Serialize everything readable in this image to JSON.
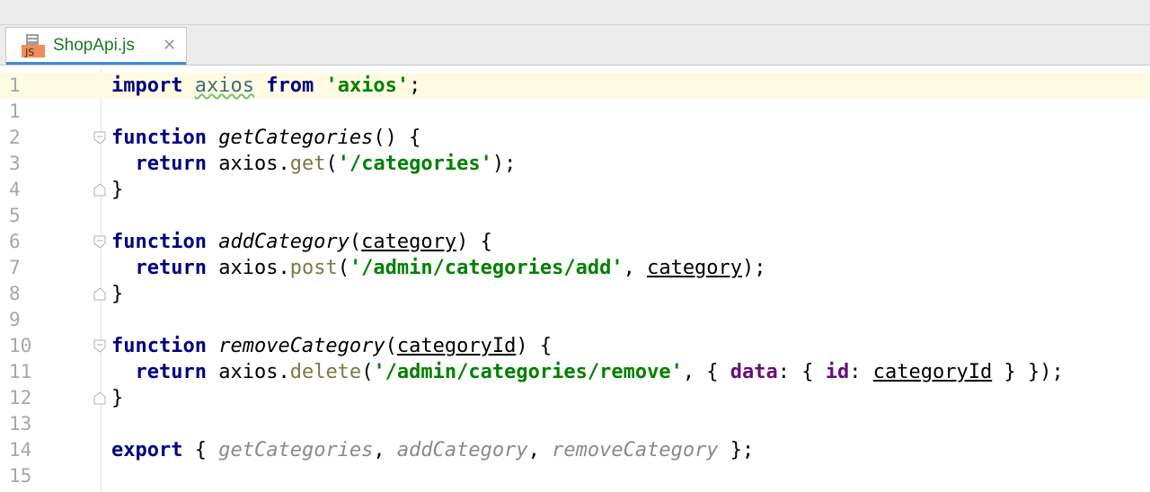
{
  "tab": {
    "filename": "ShopApi.js",
    "icon_text": "JS",
    "close_glyph": "✕"
  },
  "colors": {
    "keyword": "#000080",
    "string": "#008000",
    "method": "#7a7a43",
    "property": "#660e7a",
    "gutter_number": "#a7a7a7",
    "current_line": "#fffbe2",
    "tab_label": "#1a7a24"
  },
  "lines": [
    {
      "num": "1",
      "tokens": [
        "import",
        " ",
        "axios",
        " ",
        "from",
        " ",
        "'axios'",
        ";"
      ]
    },
    {
      "num": "1",
      "tokens": []
    },
    {
      "num": "2",
      "tokens": [
        "function",
        " ",
        "getCategories",
        "() {"
      ]
    },
    {
      "num": "3",
      "tokens": [
        "  ",
        "return",
        " axios.",
        "get",
        "(",
        "'/categories'",
        ");"
      ]
    },
    {
      "num": "4",
      "tokens": [
        "}"
      ]
    },
    {
      "num": "5",
      "tokens": []
    },
    {
      "num": "6",
      "tokens": [
        "function",
        " ",
        "addCategory",
        "(",
        "category",
        ") {"
      ]
    },
    {
      "num": "7",
      "tokens": [
        "  ",
        "return",
        " axios.",
        "post",
        "(",
        "'/admin/categories/add'",
        ", ",
        "category",
        ");"
      ]
    },
    {
      "num": "8",
      "tokens": [
        "}"
      ]
    },
    {
      "num": "9",
      "tokens": []
    },
    {
      "num": "10",
      "tokens": [
        "function",
        " ",
        "removeCategory",
        "(",
        "categoryId",
        ") {"
      ]
    },
    {
      "num": "11",
      "tokens": [
        "  ",
        "return",
        " axios.",
        "delete",
        "(",
        "'/admin/categories/remove'",
        ", { ",
        "data",
        ": { ",
        "id",
        ": ",
        "categoryId",
        " } });"
      ]
    },
    {
      "num": "12",
      "tokens": [
        "}"
      ]
    },
    {
      "num": "13",
      "tokens": []
    },
    {
      "num": "14",
      "tokens": [
        "export",
        " { ",
        "getCategories",
        ", ",
        "addCategory",
        ", ",
        "removeCategory",
        " };"
      ]
    },
    {
      "num": "15",
      "tokens": []
    }
  ]
}
